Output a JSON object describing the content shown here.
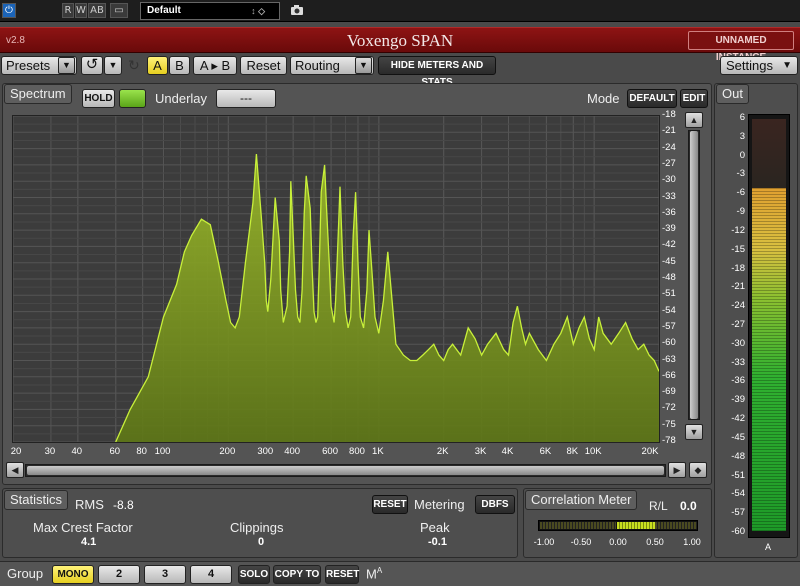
{
  "host": {
    "power_label": "⏻",
    "read_label": "R",
    "write_label": "W",
    "ab_label": "AB",
    "window_label": "▭",
    "preset_value": "Default",
    "preset_arrows": "↕ ◇",
    "camera_icon": "camera-icon"
  },
  "title_bar": {
    "version": "v2.8",
    "app_title": "Voxengo SPAN",
    "instance": "UNNAMED INSTANCE"
  },
  "toolbar": {
    "presets": "Presets",
    "a": "A",
    "b": "B",
    "a_to_b": "A ▸ B",
    "reset": "Reset",
    "routing": "Routing",
    "hide_meters": "HIDE METERS AND STATS",
    "settings": "Settings"
  },
  "spectrum": {
    "tab": "Spectrum",
    "hold": "HOLD",
    "underlay_label": "Underlay",
    "underlay_value": "---",
    "mode_label": "Mode",
    "mode_value": "DEFAULT",
    "edit": "EDIT",
    "db_ticks": [
      "-18",
      "-21",
      "-24",
      "-27",
      "-30",
      "-33",
      "-36",
      "-39",
      "-42",
      "-45",
      "-48",
      "-51",
      "-54",
      "-57",
      "-60",
      "-63",
      "-66",
      "-69",
      "-72",
      "-75",
      "-78"
    ],
    "freq_ticks": [
      "20",
      "30",
      "40",
      "60",
      "80",
      "100",
      "200",
      "300",
      "400",
      "600",
      "800",
      "1K",
      "2K",
      "3K",
      "4K",
      "6K",
      "8K",
      "10K",
      "20K"
    ]
  },
  "chart_data": {
    "type": "area",
    "x_scale": "log",
    "xlim": [
      20,
      20000
    ],
    "ylim": [
      -78,
      -18
    ],
    "grid": true,
    "x": [
      60,
      70,
      85,
      100,
      115,
      125,
      135,
      150,
      165,
      180,
      195,
      205,
      215,
      225,
      240,
      260,
      270,
      285,
      295,
      300,
      305,
      315,
      330,
      345,
      350,
      360,
      375,
      385,
      390,
      400,
      410,
      420,
      430,
      440,
      450,
      460,
      480,
      490,
      500,
      510,
      520,
      530,
      540,
      560,
      570,
      590,
      600,
      620,
      630,
      650,
      660,
      680,
      700,
      720,
      740,
      760,
      780,
      800,
      820,
      850,
      880,
      900,
      930,
      960,
      1000,
      1050,
      1100,
      1200,
      1300,
      1400,
      1500,
      1600,
      1700,
      1800,
      1900,
      2000,
      2100,
      2200,
      2400,
      2600,
      2800,
      3000,
      3200,
      3500,
      3800,
      4000,
      4200,
      4400,
      4600,
      4800,
      5000,
      5500,
      6000,
      6500,
      7000,
      7500,
      8000,
      8500,
      9000,
      9500,
      10000,
      10500,
      11000,
      12000,
      13000,
      14000,
      15000,
      16000,
      17000,
      18000,
      19000,
      20000
    ],
    "y": [
      -78,
      -72,
      -66,
      -55,
      -49,
      -43,
      -40,
      -37,
      -38,
      -45,
      -52,
      -56,
      -57,
      -55,
      -45,
      -34,
      -25,
      -37,
      -45,
      -52,
      -54,
      -48,
      -33,
      -41,
      -50,
      -56,
      -53,
      -43,
      -30,
      -40,
      -50,
      -55,
      -56,
      -50,
      -36,
      -29,
      -35,
      -46,
      -54,
      -56,
      -55,
      -44,
      -32,
      -27,
      -34,
      -46,
      -53,
      -56,
      -52,
      -38,
      -31,
      -45,
      -54,
      -57,
      -55,
      -40,
      -32,
      -45,
      -55,
      -57,
      -50,
      -39,
      -47,
      -55,
      -58,
      -52,
      -43,
      -60,
      -62,
      -63,
      -63,
      -62,
      -61,
      -60,
      -62,
      -63,
      -61,
      -60,
      -62,
      -57,
      -59,
      -62,
      -60,
      -58,
      -61,
      -62,
      -56,
      -53,
      -57,
      -60,
      -58,
      -61,
      -63,
      -60,
      -58,
      -55,
      -60,
      -57,
      -55,
      -59,
      -61,
      -55,
      -58,
      -60,
      -58,
      -56,
      -59,
      -61,
      -60,
      -62,
      -63,
      -65
    ]
  },
  "stats": {
    "tab": "Statistics",
    "rms_label": "RMS",
    "rms_value": "-8.8",
    "reset": "RESET",
    "metering_label": "Metering",
    "metering_value": "DBFS",
    "max_crest_label": "Max Crest Factor",
    "max_crest_value": "4.1",
    "clippings_label": "Clippings",
    "clippings_value": "0",
    "peak_label": "Peak",
    "peak_value": "-0.1"
  },
  "correlation": {
    "tab": "Correlation Meter",
    "rl_label": "R/L",
    "rl_value": "0.0",
    "ticks": [
      "-1.00",
      "-0.50",
      "0.00",
      "0.50",
      "1.00"
    ]
  },
  "out": {
    "tab": "Out",
    "ticks": [
      "6",
      "3",
      "0",
      "-3",
      "-6",
      "-9",
      "-12",
      "-15",
      "-18",
      "-21",
      "-24",
      "-27",
      "-30",
      "-33",
      "-36",
      "-39",
      "-42",
      "-45",
      "-48",
      "-51",
      "-54",
      "-57",
      "-60"
    ],
    "channel": "A",
    "level_db": -5
  },
  "group": {
    "label": "Group",
    "mono": "MONO",
    "g2": "2",
    "g3": "3",
    "g4": "4",
    "solo": "SOLO",
    "copy_to": "COPY TO",
    "reset": "RESET",
    "ma": "M",
    "ma_sup": "A"
  }
}
